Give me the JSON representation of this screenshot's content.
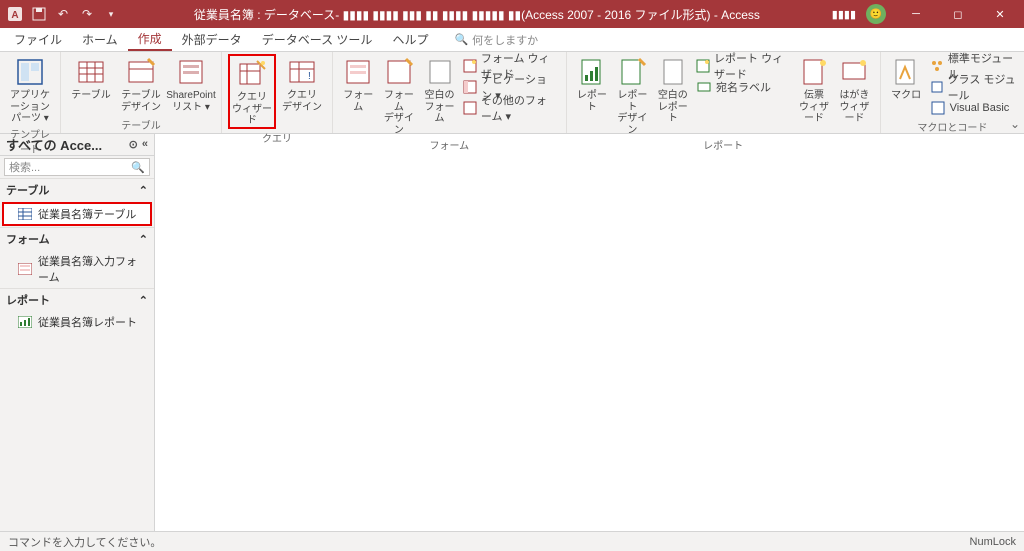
{
  "titlebar": {
    "title": "従業員名簿 : データベース- ▮▮▮▮ ▮▮▮▮ ▮▮▮ ▮▮ ▮▮▮▮ ▮▮▮▮▮ ▮▮(Access 2007 - 2016 ファイル形式)  -  Access",
    "account": "▮▮▮▮"
  },
  "tabs": {
    "file": "ファイル",
    "home": "ホーム",
    "create": "作成",
    "external": "外部データ",
    "dbtools": "データベース ツール",
    "help": "ヘルプ",
    "tellme_placeholder": "何をしますか"
  },
  "ribbon": {
    "templates": {
      "label": "テンプレート",
      "app_parts": "アプリケーション\nパーツ ▾"
    },
    "tables": {
      "label": "テーブル",
      "table": "テーブル",
      "table_design": "テーブル\nデザイン",
      "sharepoint": "SharePoint\nリスト ▾"
    },
    "queries": {
      "label": "クエリ",
      "query_wizard": "クエリ\nウィザード",
      "query_design": "クエリ\nデザイン"
    },
    "forms": {
      "label": "フォーム",
      "form": "フォーム",
      "form_design": "フォーム\nデザイン",
      "blank_form": "空白の\nフォーム",
      "form_wizard": "フォーム ウィザード",
      "navigation": "ナビゲーション ▾",
      "other_forms": "その他のフォーム ▾"
    },
    "reports": {
      "label": "レポート",
      "report": "レポート",
      "report_design": "レポート\nデザイン",
      "blank_report": "空白の\nレポート",
      "report_wizard": "レポート ウィザード",
      "labels": "宛名ラベル",
      "invoice_wizard": "伝票\nウィザード",
      "postcard_wizard": "はがき\nウィザード"
    },
    "macros": {
      "label": "マクロとコード",
      "macro": "マクロ",
      "module": "標準モジュール",
      "class_module": "クラス モジュール",
      "vb": "Visual Basic"
    }
  },
  "nav": {
    "title": "すべての Acce...",
    "search_placeholder": "検索...",
    "tables_header": "テーブル",
    "table_item": "従業員名簿テーブル",
    "forms_header": "フォーム",
    "form_item": "従業員名簿入力フォーム",
    "reports_header": "レポート",
    "report_item": "従業員名簿レポート"
  },
  "status": {
    "left": "コマンドを入力してください。",
    "numlock": "NumLock"
  }
}
